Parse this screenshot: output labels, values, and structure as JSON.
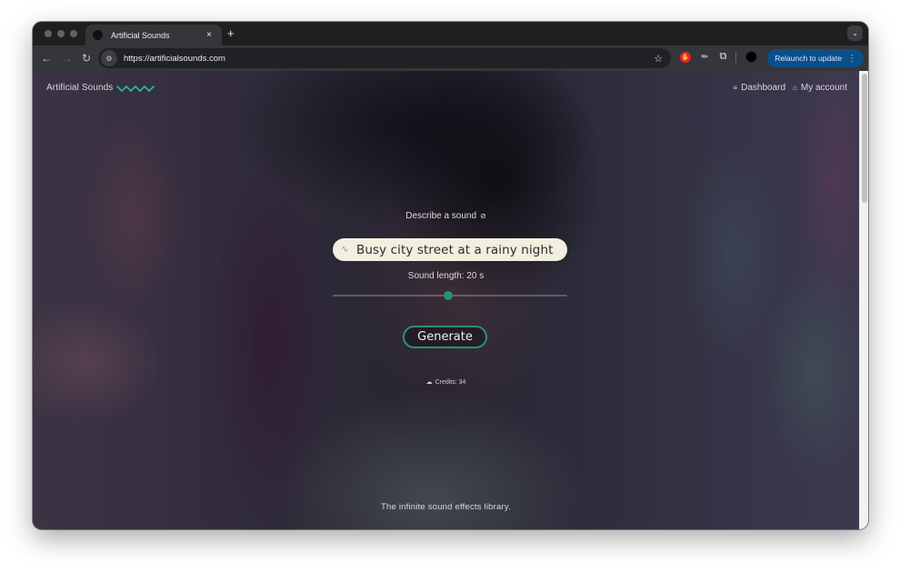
{
  "browser": {
    "tab": {
      "title": "Artificial Sounds",
      "close_icon": "×"
    },
    "new_tab_icon": "+",
    "tab_menu_icon": "⌄",
    "nav": {
      "back_icon": "←",
      "forward_icon": "→",
      "reload_icon": "↻"
    },
    "site_info_icon": "⚙",
    "url": "https://artificialsounds.com",
    "bookmark_icon": "☆",
    "extensions_icon": "⧉",
    "relaunch_label": "Relaunch to update",
    "menu_icon": "⋮"
  },
  "page": {
    "brand": {
      "name": "Artificial Sounds",
      "accent_color": "#2bb598"
    },
    "nav": [
      {
        "label": "Dashboard",
        "icon": "≡"
      },
      {
        "label": "My account",
        "icon": "⌂"
      }
    ],
    "describe_label": "Describe a sound",
    "help_icon": "⊘",
    "prompt": {
      "value": "Busy city street at a rainy night",
      "icon": "∿"
    },
    "length_label": "Sound length: 20 s",
    "slider": {
      "value_seconds": 20,
      "fraction": 0.49,
      "thumb_color": "#2b8f74"
    },
    "generate_label": "Generate",
    "credits": {
      "icon": "☁",
      "label": "Credits: 34"
    },
    "tagline": "The infinite sound effects library."
  }
}
